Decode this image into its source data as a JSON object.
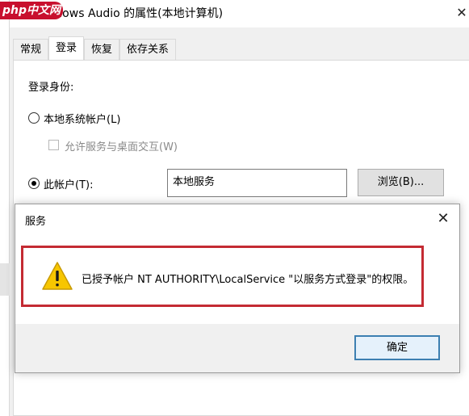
{
  "watermark": "php中文网",
  "window": {
    "title": "Windows Audio 的属性(本地计算机)",
    "close_glyph": "✕"
  },
  "tabs": [
    {
      "label": "常规"
    },
    {
      "label": "登录",
      "active": true
    },
    {
      "label": "恢复"
    },
    {
      "label": "依存关系"
    }
  ],
  "logon": {
    "heading": "登录身份:",
    "local_system_label": "本地系统帐户(L)",
    "local_system_selected": false,
    "allow_interact_label": "允许服务与桌面交互(W)",
    "allow_interact_checked": false,
    "this_account_label": "此帐户(T):",
    "this_account_selected": true,
    "account_value": "本地服务",
    "browse_label": "浏览(B)..."
  },
  "dialog": {
    "title": "服务",
    "close_glyph": "✕",
    "icon": "warning-icon",
    "message": "已授予帐户 NT AUTHORITY\\LocalService \"以服务方式登录\"的权限。",
    "ok_label": "确定"
  },
  "colors": {
    "highlight_border": "#c42b33",
    "warning_fill": "#f7c600",
    "ok_button_border": "#3c7fb1",
    "watermark_bg": "#c8102e"
  }
}
